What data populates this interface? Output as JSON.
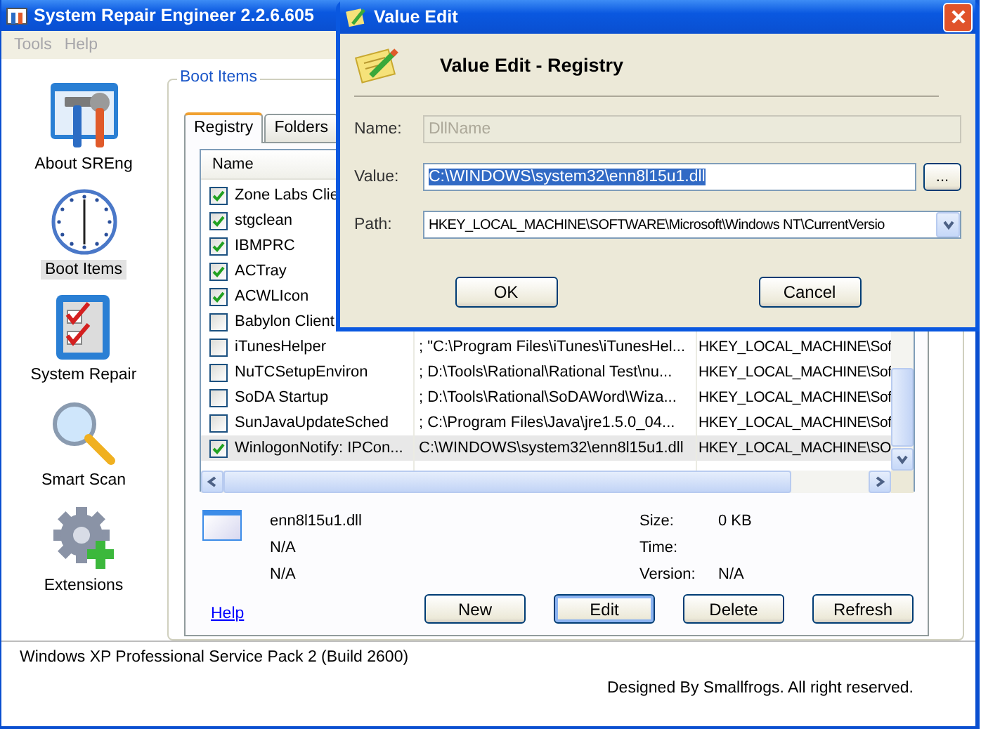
{
  "main_window": {
    "title": "System Repair Engineer 2.2.6.605"
  },
  "menu": [
    {
      "label": "Tools",
      "disabled": true
    },
    {
      "label": "Help",
      "disabled": true
    }
  ],
  "sidebar": {
    "items": [
      {
        "label": "About SREng",
        "kind": "tools",
        "selected": false
      },
      {
        "label": "Boot Items",
        "kind": "clock",
        "selected": true
      },
      {
        "label": "System Repair",
        "kind": "checklist",
        "selected": false
      },
      {
        "label": "Smart Scan",
        "kind": "magnifier",
        "selected": false
      },
      {
        "label": "Extensions",
        "kind": "gear",
        "selected": false
      }
    ]
  },
  "group": {
    "title": "Boot Items",
    "tabs": [
      {
        "label": "Registry",
        "selected": true
      },
      {
        "label": "Folders",
        "selected": false
      }
    ],
    "table": {
      "columns": [
        "Name"
      ],
      "rows": [
        {
          "checked": true,
          "selected": false,
          "name": "Zone Labs Clie"
        },
        {
          "checked": true,
          "selected": false,
          "name": "stgclean"
        },
        {
          "checked": true,
          "selected": false,
          "name": "IBMPRC"
        },
        {
          "checked": true,
          "selected": false,
          "name": "ACTray"
        },
        {
          "checked": true,
          "selected": false,
          "name": "ACWLIcon"
        },
        {
          "checked": false,
          "selected": false,
          "name": "Babylon Client"
        },
        {
          "checked": false,
          "selected": false,
          "name": "iTunesHelper",
          "command": "; \"C:\\Program Files\\iTunes\\iTunesHel...",
          "key": "HKEY_LOCAL_MACHINE\\Sof"
        },
        {
          "checked": false,
          "selected": false,
          "name": "NuTCSetupEnviron",
          "command": "; D:\\Tools\\Rational\\Rational Test\\nu...",
          "key": "HKEY_LOCAL_MACHINE\\Sof"
        },
        {
          "checked": false,
          "selected": false,
          "name": "SoDA Startup",
          "command": "; D:\\Tools\\Rational\\SoDAWord\\Wiza...",
          "key": "HKEY_LOCAL_MACHINE\\Sof"
        },
        {
          "checked": false,
          "selected": false,
          "name": "SunJavaUpdateSched",
          "command": "; C:\\Program Files\\Java\\jre1.5.0_04...",
          "key": "HKEY_LOCAL_MACHINE\\Sof"
        },
        {
          "checked": true,
          "selected": true,
          "name": "WinlogonNotify: IPCon...",
          "command": "C:\\WINDOWS\\system32\\enn8l15u1.dll",
          "key": "HKEY_LOCAL_MACHINE\\SO"
        }
      ]
    },
    "details": {
      "lines": [
        "enn8l15u1.dll",
        "N/A",
        "N/A"
      ],
      "properties": [
        {
          "label": "Size:",
          "value": "0 KB"
        },
        {
          "label": "Time:"
        },
        {
          "label": "Version:",
          "value": "N/A"
        }
      ]
    },
    "help_link": "Help",
    "buttons": [
      {
        "label": "New",
        "focused": false
      },
      {
        "label": "Edit",
        "focused": true
      },
      {
        "label": "Delete",
        "focused": false
      },
      {
        "label": "Refresh",
        "focused": false
      }
    ]
  },
  "status_bar": {
    "system": "Windows XP Professional Service Pack 2 (Build 2600)",
    "credit": "Designed By Smallfrogs. All right reserved."
  },
  "dialog": {
    "title": "Value Edit",
    "heading": "Value Edit - Registry",
    "fields": [
      {
        "kind": "text",
        "label": "Name:",
        "value": "DllName",
        "disabled": true,
        "text_selected": false
      },
      {
        "kind": "browse",
        "label": "Value:",
        "value": "C:\\WINDOWS\\system32\\enn8l15u1.dll",
        "disabled": false,
        "text_selected": true,
        "button": "..."
      },
      {
        "kind": "dropdown",
        "label": "Path:",
        "value": "HKEY_LOCAL_MACHINE\\SOFTWARE\\Microsoft\\Windows NT\\CurrentVersio",
        "disabled": false,
        "text_selected": false
      }
    ],
    "buttons": [
      "OK",
      "Cancel"
    ]
  }
}
